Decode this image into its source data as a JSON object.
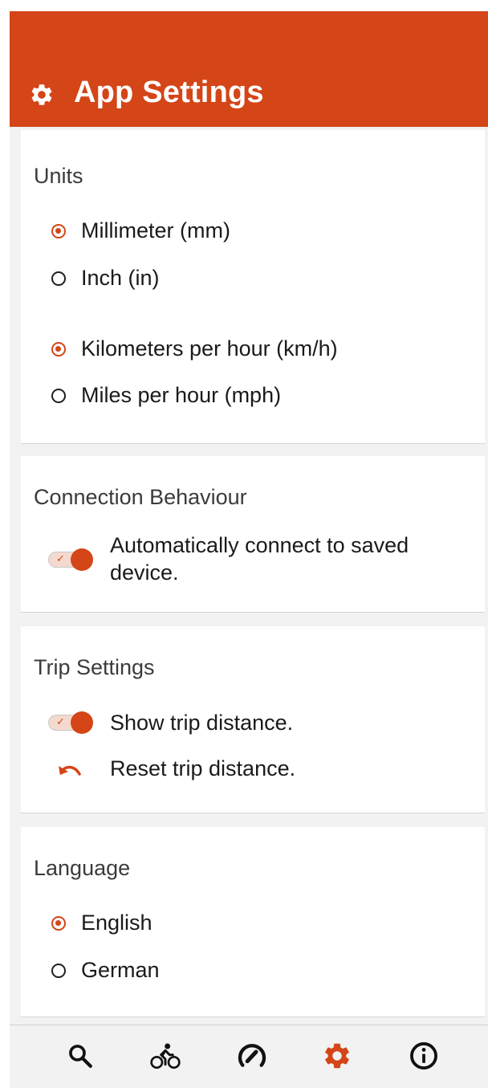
{
  "header": {
    "title": "App Settings",
    "icon": "gear-icon"
  },
  "units": {
    "title": "Units",
    "length_options": [
      {
        "label": "Millimeter (mm)",
        "selected": true
      },
      {
        "label": "Inch (in)",
        "selected": false
      }
    ],
    "speed_options": [
      {
        "label": "Kilometers per hour (km/h)",
        "selected": true
      },
      {
        "label": "Miles per hour (mph)",
        "selected": false
      }
    ]
  },
  "connection": {
    "title": "Connection Behaviour",
    "auto_connect_label": "Automatically connect to saved device.",
    "auto_connect_on": true
  },
  "trip": {
    "title": "Trip Settings",
    "show_distance_label": "Show trip distance.",
    "show_distance_on": true,
    "reset_label": "Reset trip distance."
  },
  "language": {
    "title": "Language",
    "options": [
      {
        "label": "English",
        "selected": true
      },
      {
        "label": "German",
        "selected": false
      }
    ]
  },
  "navbar": {
    "items": [
      "search-icon",
      "cyclist-icon",
      "speedometer-icon",
      "gear-icon",
      "info-icon"
    ],
    "active": "gear-icon"
  },
  "colors": {
    "accent": "#d44517",
    "background": "#f2f2f2",
    "card": "#ffffff"
  }
}
